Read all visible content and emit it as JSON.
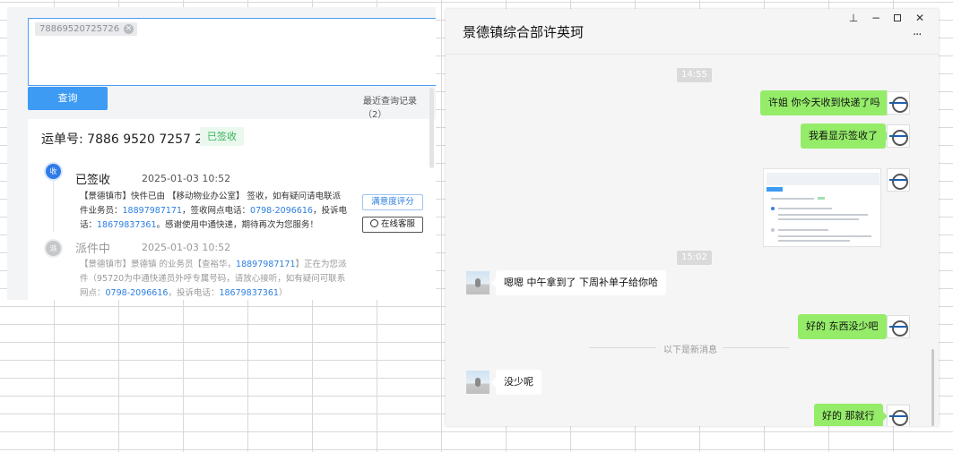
{
  "tracking": {
    "tag_value": "78869520725726",
    "tag_close": "×",
    "query_button": "查询",
    "recent_queries": "最近查询记录（2）",
    "waybill": "运单号: 7886 9520 7257 26",
    "status_badge": "已签收",
    "events": [
      {
        "icon_text": "收",
        "title": "已签收",
        "time": "2025-01-03 10:52",
        "desc_parts": [
          "【景德镇市】快件已由 【移动物业办公室】 签收，如有疑问请电联派件业务员：",
          "18897987171",
          "，签收网点电话：",
          "0798-2096616",
          "，投诉电话：",
          "18679837361",
          "。感谢使用中通快递，期待再次为您服务！"
        ]
      },
      {
        "icon_text": "派",
        "title": "派件中",
        "time": "2025-01-03 10:52",
        "desc_parts": [
          "【景德镇市】景德镇 的业务员【查裕华，",
          "18897987171",
          "】正在为您派件（95720为中通快递员外呼专属号码，请放心接听，如有疑问可联系网点：",
          "0798-2096616",
          "，投诉电话：",
          "18679837361",
          "）"
        ]
      }
    ],
    "rate_button": "满意度评分",
    "service_button": "在线客服"
  },
  "chat": {
    "title": "景德镇综合部许英珂",
    "window_controls": {
      "pin": "⊥",
      "minimize": "−",
      "close": "✕"
    },
    "more": "···",
    "time_labels": [
      "14:55",
      "15:02"
    ],
    "messages": [
      {
        "from": "me",
        "text": "许姐 你今天收到快递了吗"
      },
      {
        "from": "me",
        "text": "我看显示签收了"
      },
      {
        "from": "me",
        "type": "image"
      },
      {
        "from": "them",
        "text": "嗯嗯  中午拿到了  下周补单子给你哈"
      },
      {
        "from": "me",
        "text": "好的 东西没少吧"
      },
      {
        "from": "them",
        "text": "没少呢"
      },
      {
        "from": "me",
        "text": "好的   那就行"
      }
    ],
    "new_message_divider": "以下是新消息"
  },
  "colors": {
    "accent_blue": "#3d9bf3",
    "link_blue": "#2c7fe0",
    "signed_green": "#37b35b",
    "bubble_green": "#95ec69"
  }
}
